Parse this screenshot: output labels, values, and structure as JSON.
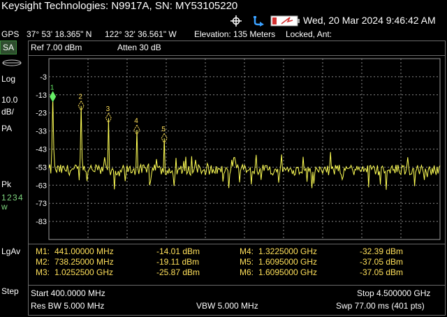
{
  "header": {
    "title": "Keysight Technologies: N9917A, SN: MY53105220",
    "datetime": "Wed, 20 Mar 2024 9:46:42 AM"
  },
  "gps": {
    "label": "GPS",
    "lat": "37° 53' 18.365\" N",
    "lon": "122° 32' 36.561\" W",
    "elevation": "Elevation: 135 Meters",
    "lock": "Locked, Ant:"
  },
  "left_panel": {
    "mode": "SA",
    "scale_type": "Log",
    "scale_value": "10.0",
    "scale_unit": "dB/",
    "preamp": "PA",
    "detector": "Pk",
    "traces": "1 2 3 4",
    "trace_mode": "w",
    "averaging": "LgAv",
    "step": "Step"
  },
  "settings": {
    "ref": "Ref 7.00 dBm",
    "atten": "Atten 30 dB"
  },
  "colors": {
    "trace": "#ffff55",
    "marker_text": "#ffe05a",
    "grid": "#8c8c8c",
    "active_marker": "#66ee66"
  },
  "chart_data": {
    "type": "line",
    "y_ticks": [
      "-3",
      "-13",
      "-23",
      "-33",
      "-43",
      "-53",
      "-63",
      "-73",
      "-83"
    ],
    "ylim": [
      -93,
      7
    ],
    "xlim_mhz": [
      400,
      4500
    ],
    "points": 401,
    "noise_floor_dbm": -53,
    "markers": [
      {
        "id": "1",
        "freq_mhz": 441.0,
        "level_dbm": -14.01
      },
      {
        "id": "2",
        "freq_mhz": 738.25,
        "level_dbm": -19.11
      },
      {
        "id": "3",
        "freq_mhz": 1025.25,
        "level_dbm": -25.87
      },
      {
        "id": "4",
        "freq_mhz": 1322.5,
        "level_dbm": -32.39
      },
      {
        "id": "5",
        "freq_mhz": 1609.5,
        "level_dbm": -37.05
      }
    ]
  },
  "marker_table": {
    "rows": [
      {
        "name": "M1:",
        "freq": "441.00000 MHz",
        "level": "-14.01 dBm",
        "name2": "M4:",
        "freq2": "1.3225000 GHz",
        "level2": "-32.39 dBm"
      },
      {
        "name": "M2:",
        "freq": "738.25000 MHz",
        "level": "-19.11 dBm",
        "name2": "M5:",
        "freq2": "1.6095000 GHz",
        "level2": "-37.05 dBm"
      },
      {
        "name": "M3:",
        "freq": "1.0252500 GHz",
        "level": "-25.87 dBm",
        "name2": "M6:",
        "freq2": "1.6095000 GHz",
        "level2": "-37.05 dBm"
      }
    ]
  },
  "footer": {
    "start": "Start 400.0000 MHz",
    "stop": "Stop 4.500000 GHz",
    "rbw": "Res BW 5.000 MHz",
    "vbw": "VBW 5.000 MHz",
    "sweep": "Swp 77.00 ms (401 pts)"
  }
}
